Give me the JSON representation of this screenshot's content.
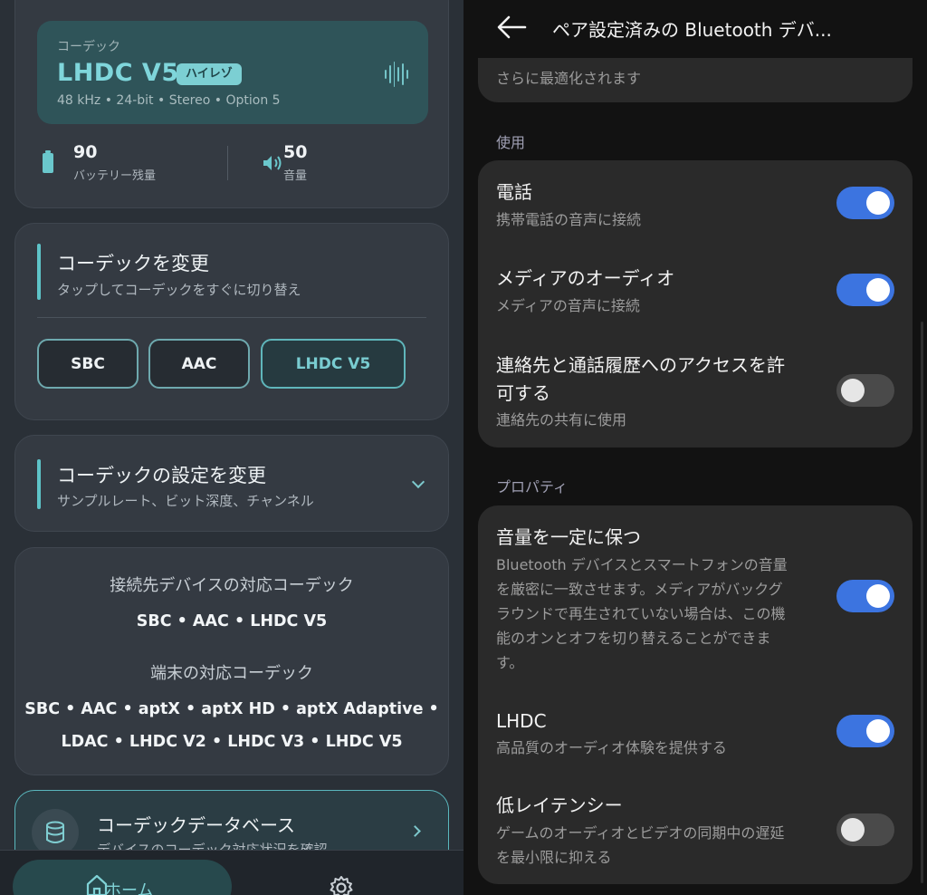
{
  "left": {
    "codec_card": {
      "caption": "コーデック",
      "name": "LHDC V5",
      "badge": "ハイレゾ",
      "detail": "48 kHz • 24-bit • Stereo • Option 5",
      "icon": "audio-wave-icon"
    },
    "stats": {
      "battery_value": "90",
      "battery_label": "バッテリー残量",
      "volume_value": "50",
      "volume_label": "音量"
    },
    "change_codec": {
      "title": "コーデックを変更",
      "subtitle": "タップしてコーデックをすぐに切り替え",
      "buttons": [
        "SBC",
        "AAC",
        "LHDC V5"
      ],
      "active": "LHDC V5"
    },
    "codec_settings": {
      "title": "コーデックの設定を変更",
      "subtitle": "サンプルレート、ビット深度、チャンネル"
    },
    "support": {
      "device_heading": "接続先デバイスの対応コーデック",
      "device_codecs": "SBC • AAC • LHDC V5",
      "phone_heading": "端末の対応コーデック",
      "phone_codecs_line1": "SBC • AAC • aptX • aptX HD • aptX Adaptive •",
      "phone_codecs_line2": "LDAC • LHDC V2 • LHDC V3 • LHDC V5"
    },
    "database": {
      "title": "コーデックデータベース",
      "subtitle": "デバイスのコーデック対応状況を確認"
    },
    "nav": {
      "home_label": "ホーム"
    },
    "colors": {
      "accent": "#5ec3c8",
      "card": "#343a42",
      "background": "#2a3037"
    }
  },
  "right": {
    "app_bar": {
      "title": "ペア設定済みの Bluetooth デバ..."
    },
    "top_card_text": "さらに最適化されます",
    "usage_label": "使用",
    "usage_rows": [
      {
        "title": "電話",
        "subtitle": "携帯電話の音声に接続",
        "on": true
      },
      {
        "title": "メディアのオーディオ",
        "subtitle": "メディアの音声に接続",
        "on": true
      },
      {
        "title_line1": "連絡先と通話履歴へのアクセスを許",
        "title_line2": "可する",
        "subtitle": "連絡先の共有に使用",
        "on": false
      }
    ],
    "properties_label": "プロパティ",
    "property_rows": [
      {
        "title": "音量を一定に保つ",
        "subtitle_lines": [
          "Bluetooth デバイスとスマートフォンの音量",
          "を厳密に一致させます。メディアがバックグ",
          "ラウンドで再生されていない場合は、この機",
          "能のオンとオフを切り替えることができま",
          "す。"
        ],
        "on": true
      },
      {
        "title": "LHDC",
        "subtitle": "高品質のオーディオ体験を提供する",
        "on": true
      },
      {
        "title": "低レイテンシー",
        "subtitle_lines": [
          "ゲームのオーディオとビデオの同期中の遅延",
          "を最小限に抑える"
        ],
        "on": false
      }
    ],
    "colors": {
      "toggle_on": "#3c74e0",
      "toggle_off": "#4a4a4a",
      "card": "#2a2a2a"
    }
  }
}
